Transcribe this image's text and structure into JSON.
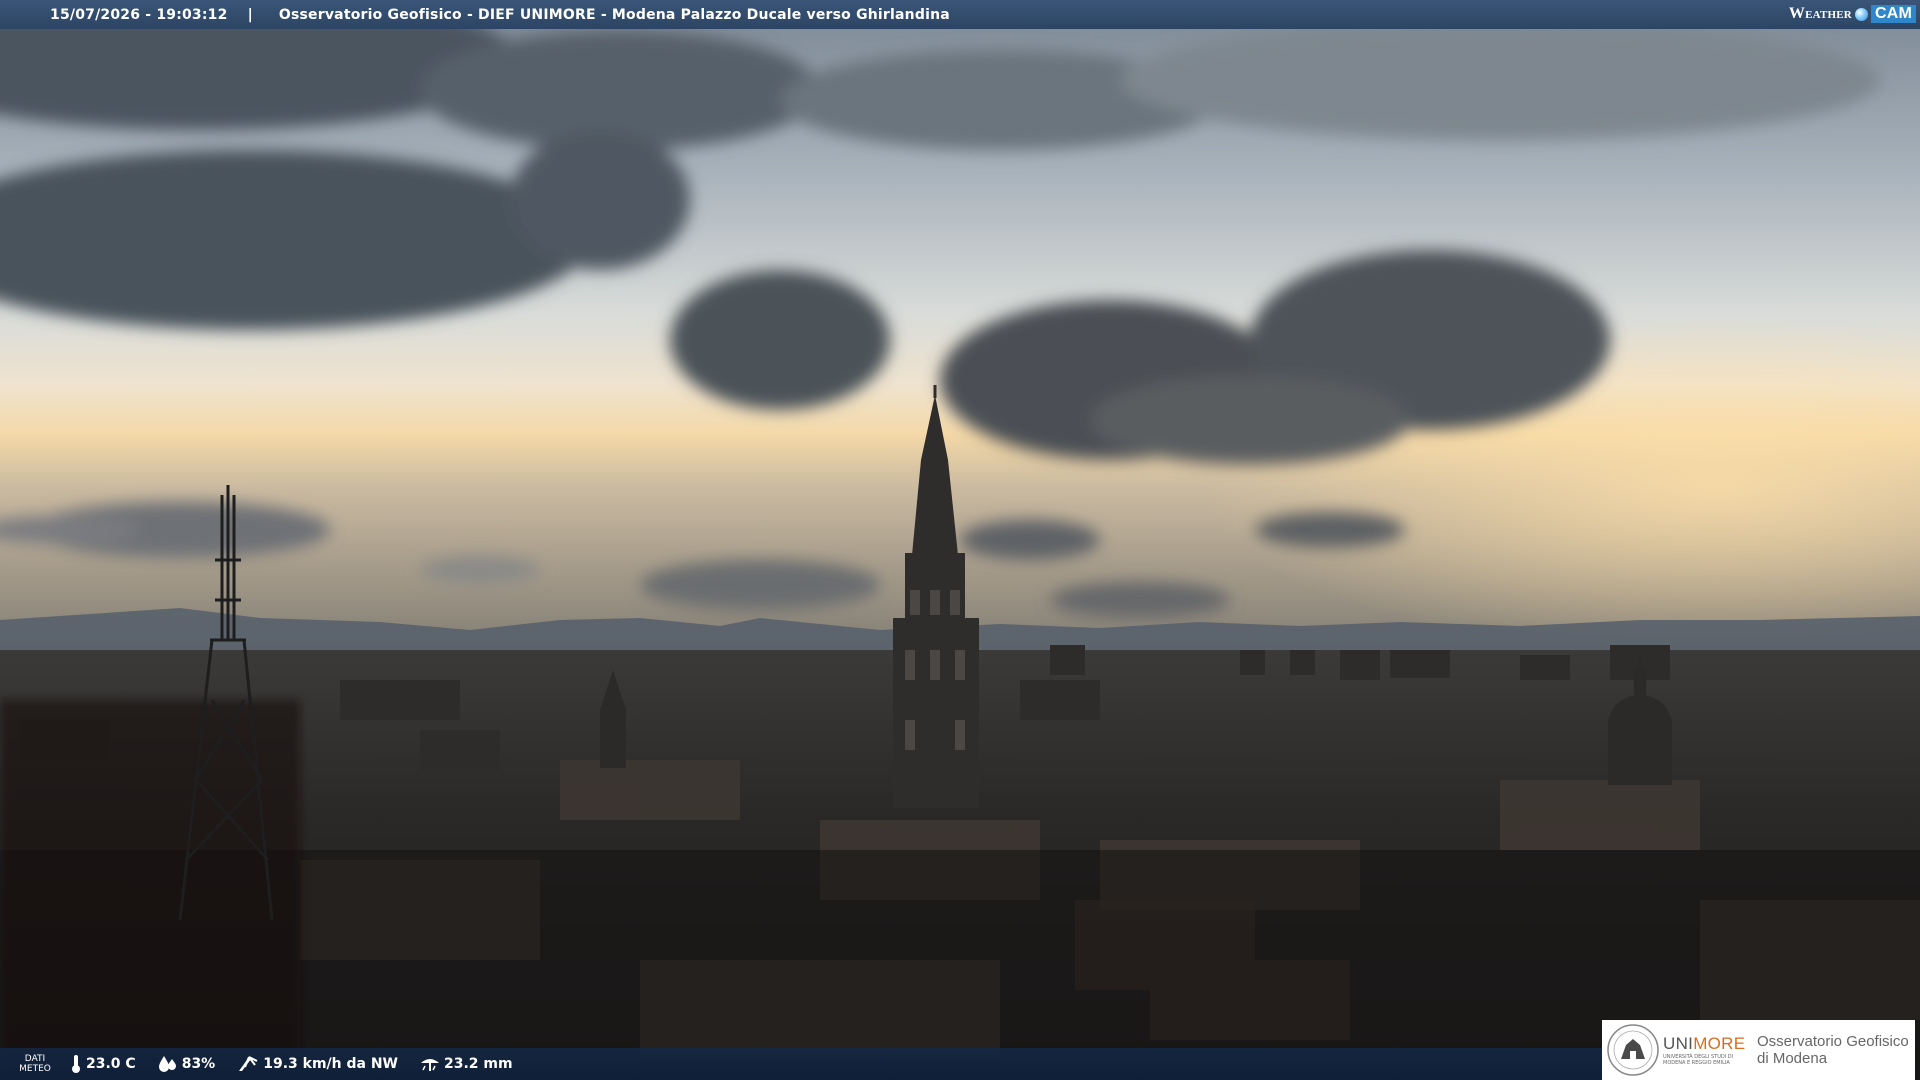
{
  "overlay": {
    "timestamp": "15/07/2026 - 19:03:12",
    "separator": "|",
    "camera_title": "Osservatorio Geofisico - DIEF UNIMORE - Modena Palazzo Ducale verso Ghirlandina"
  },
  "brand": {
    "weather": "Weather",
    "cam": "CAM"
  },
  "meteo": {
    "label_line1": "DATI",
    "label_line2": "METEO",
    "temperature": "23.0 C",
    "temperature_icon": "thermometer-icon",
    "humidity": "83%",
    "humidity_icon": "droplets-icon",
    "wind": "19.3 km/h da NW",
    "wind_icon": "wind-icon",
    "rain": "23.2 mm",
    "rain_icon": "rain-icon"
  },
  "logos": {
    "uni_part1": "UNI",
    "uni_part2": "MORE",
    "uni_sub": "UNIVERSITÀ DEGLI STUDI DI MODENA E REGGIO EMILIA",
    "observatory_line1": "Osservatorio Geofisico",
    "observatory_line2": "di Modena"
  },
  "colors": {
    "topbar": "#2d4564",
    "accent_orange": "#d86d1c",
    "sky_glow": "#f4d9a8"
  }
}
